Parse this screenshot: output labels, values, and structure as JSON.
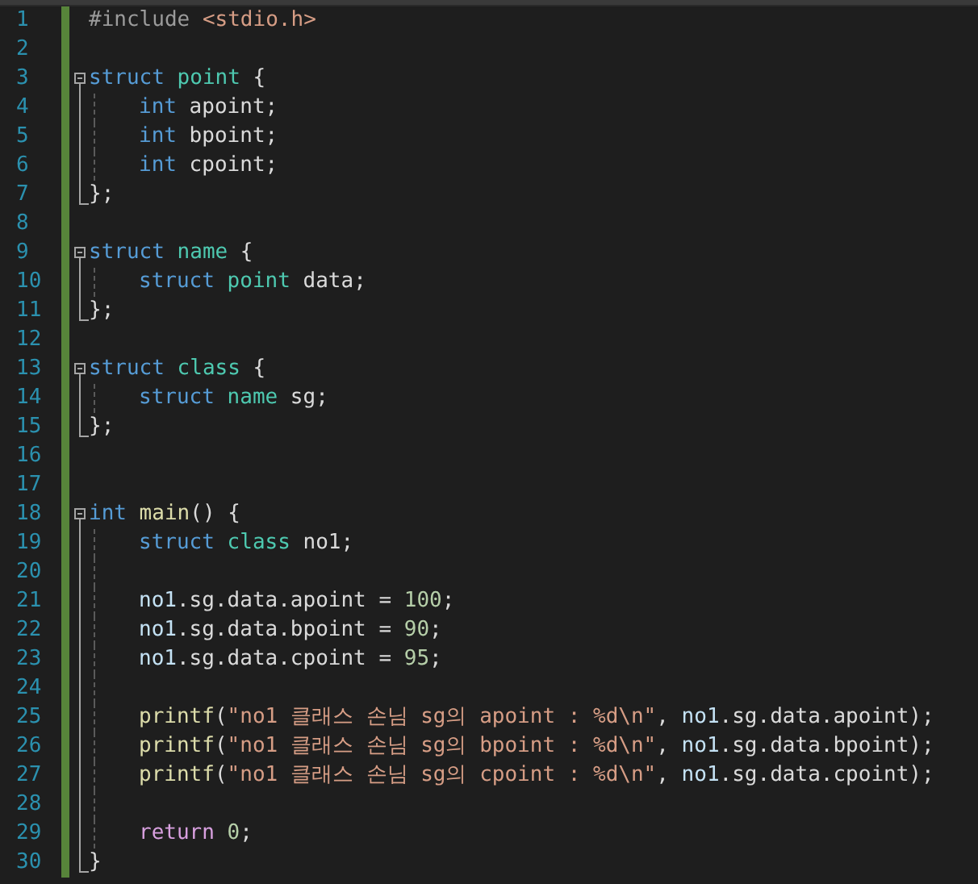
{
  "editor": {
    "lines": [
      {
        "number": "1",
        "tokens": [
          {
            "kind": "preproc",
            "text": "#include"
          },
          {
            "kind": "string",
            "text": " <stdio.h>"
          }
        ]
      },
      {
        "number": "2"
      },
      {
        "number": "3",
        "kind": "open",
        "tokens": [
          {
            "kind": "keyword",
            "text": "struct"
          },
          {
            "kind": "type",
            "text": " point"
          },
          {
            "kind": "plain",
            "text": " {"
          }
        ]
      },
      {
        "number": "4",
        "kind": "inner",
        "tokens": [
          {
            "kind": "keyword",
            "text": "int"
          },
          {
            "kind": "plain",
            "text": " apoint;"
          }
        ]
      },
      {
        "number": "5",
        "kind": "inner",
        "tokens": [
          {
            "kind": "keyword",
            "text": "int"
          },
          {
            "kind": "plain",
            "text": " bpoint;"
          }
        ]
      },
      {
        "number": "6",
        "kind": "inner",
        "tokens": [
          {
            "kind": "keyword",
            "text": "int"
          },
          {
            "kind": "plain",
            "text": " cpoint;"
          }
        ]
      },
      {
        "number": "7",
        "kind": "close",
        "tokens": [
          {
            "kind": "plain",
            "text": "};"
          }
        ]
      },
      {
        "number": "8"
      },
      {
        "number": "9",
        "kind": "open",
        "tokens": [
          {
            "kind": "keyword",
            "text": "struct"
          },
          {
            "kind": "type",
            "text": " name"
          },
          {
            "kind": "plain",
            "text": " {"
          }
        ]
      },
      {
        "number": "10",
        "kind": "inner",
        "tokens": [
          {
            "kind": "keyword",
            "text": "struct"
          },
          {
            "kind": "type",
            "text": " point"
          },
          {
            "kind": "plain",
            "text": " data;"
          }
        ]
      },
      {
        "number": "11",
        "kind": "close",
        "tokens": [
          {
            "kind": "plain",
            "text": "};"
          }
        ]
      },
      {
        "number": "12"
      },
      {
        "number": "13",
        "kind": "open",
        "tokens": [
          {
            "kind": "keyword",
            "text": "struct"
          },
          {
            "kind": "type",
            "text": " class"
          },
          {
            "kind": "plain",
            "text": " {"
          }
        ]
      },
      {
        "number": "14",
        "kind": "inner",
        "tokens": [
          {
            "kind": "keyword",
            "text": "struct"
          },
          {
            "kind": "type",
            "text": " name"
          },
          {
            "kind": "plain",
            "text": " sg;"
          }
        ]
      },
      {
        "number": "15",
        "kind": "close",
        "tokens": [
          {
            "kind": "plain",
            "text": "};"
          }
        ]
      },
      {
        "number": "16"
      },
      {
        "number": "17"
      },
      {
        "number": "18",
        "kind": "open",
        "tokens": [
          {
            "kind": "keyword",
            "text": "int"
          },
          {
            "kind": "func",
            "text": " main"
          },
          {
            "kind": "plain",
            "text": "() {"
          }
        ]
      },
      {
        "number": "19",
        "kind": "inner",
        "tokens": [
          {
            "kind": "keyword",
            "text": "struct"
          },
          {
            "kind": "type",
            "text": " class"
          },
          {
            "kind": "plain",
            "text": " no1;"
          }
        ]
      },
      {
        "number": "20",
        "kind": "inner"
      },
      {
        "number": "21",
        "kind": "inner",
        "tokens": [
          {
            "kind": "var",
            "text": "no1"
          },
          {
            "kind": "plain",
            "text": ".sg.data.apoint = "
          },
          {
            "kind": "number",
            "text": "100"
          },
          {
            "kind": "plain",
            "text": ";"
          }
        ]
      },
      {
        "number": "22",
        "kind": "inner",
        "tokens": [
          {
            "kind": "var",
            "text": "no1"
          },
          {
            "kind": "plain",
            "text": ".sg.data.bpoint = "
          },
          {
            "kind": "number",
            "text": "90"
          },
          {
            "kind": "plain",
            "text": ";"
          }
        ]
      },
      {
        "number": "23",
        "kind": "inner",
        "tokens": [
          {
            "kind": "var",
            "text": "no1"
          },
          {
            "kind": "plain",
            "text": ".sg.data.cpoint = "
          },
          {
            "kind": "number",
            "text": "95"
          },
          {
            "kind": "plain",
            "text": ";"
          }
        ]
      },
      {
        "number": "24",
        "kind": "inner"
      },
      {
        "number": "25",
        "kind": "inner",
        "tokens": [
          {
            "kind": "func",
            "text": "printf"
          },
          {
            "kind": "plain",
            "text": "("
          },
          {
            "kind": "string",
            "text": "\"no1 클래스 손님 sg의 apoint : %d\\n\""
          },
          {
            "kind": "plain",
            "text": ", "
          },
          {
            "kind": "var",
            "text": "no1"
          },
          {
            "kind": "plain",
            "text": ".sg.data.apoint);"
          }
        ]
      },
      {
        "number": "26",
        "kind": "inner",
        "tokens": [
          {
            "kind": "func",
            "text": "printf"
          },
          {
            "kind": "plain",
            "text": "("
          },
          {
            "kind": "string",
            "text": "\"no1 클래스 손님 sg의 bpoint : %d\\n\""
          },
          {
            "kind": "plain",
            "text": ", "
          },
          {
            "kind": "var",
            "text": "no1"
          },
          {
            "kind": "plain",
            "text": ".sg.data.bpoint);"
          }
        ]
      },
      {
        "number": "27",
        "kind": "inner",
        "tokens": [
          {
            "kind": "func",
            "text": "printf"
          },
          {
            "kind": "plain",
            "text": "("
          },
          {
            "kind": "string",
            "text": "\"no1 클래스 손님 sg의 cpoint : %d\\n\""
          },
          {
            "kind": "plain",
            "text": ", "
          },
          {
            "kind": "var",
            "text": "no1"
          },
          {
            "kind": "plain",
            "text": ".sg.data.cpoint);"
          }
        ]
      },
      {
        "number": "28",
        "kind": "inner"
      },
      {
        "number": "29",
        "kind": "inner",
        "tokens": [
          {
            "kind": "control",
            "text": "return"
          },
          {
            "kind": "number",
            "text": " 0"
          },
          {
            "kind": "plain",
            "text": ";"
          }
        ]
      },
      {
        "number": "30",
        "kind": "close",
        "tokens": [
          {
            "kind": "plain",
            "text": "}"
          }
        ]
      }
    ]
  }
}
